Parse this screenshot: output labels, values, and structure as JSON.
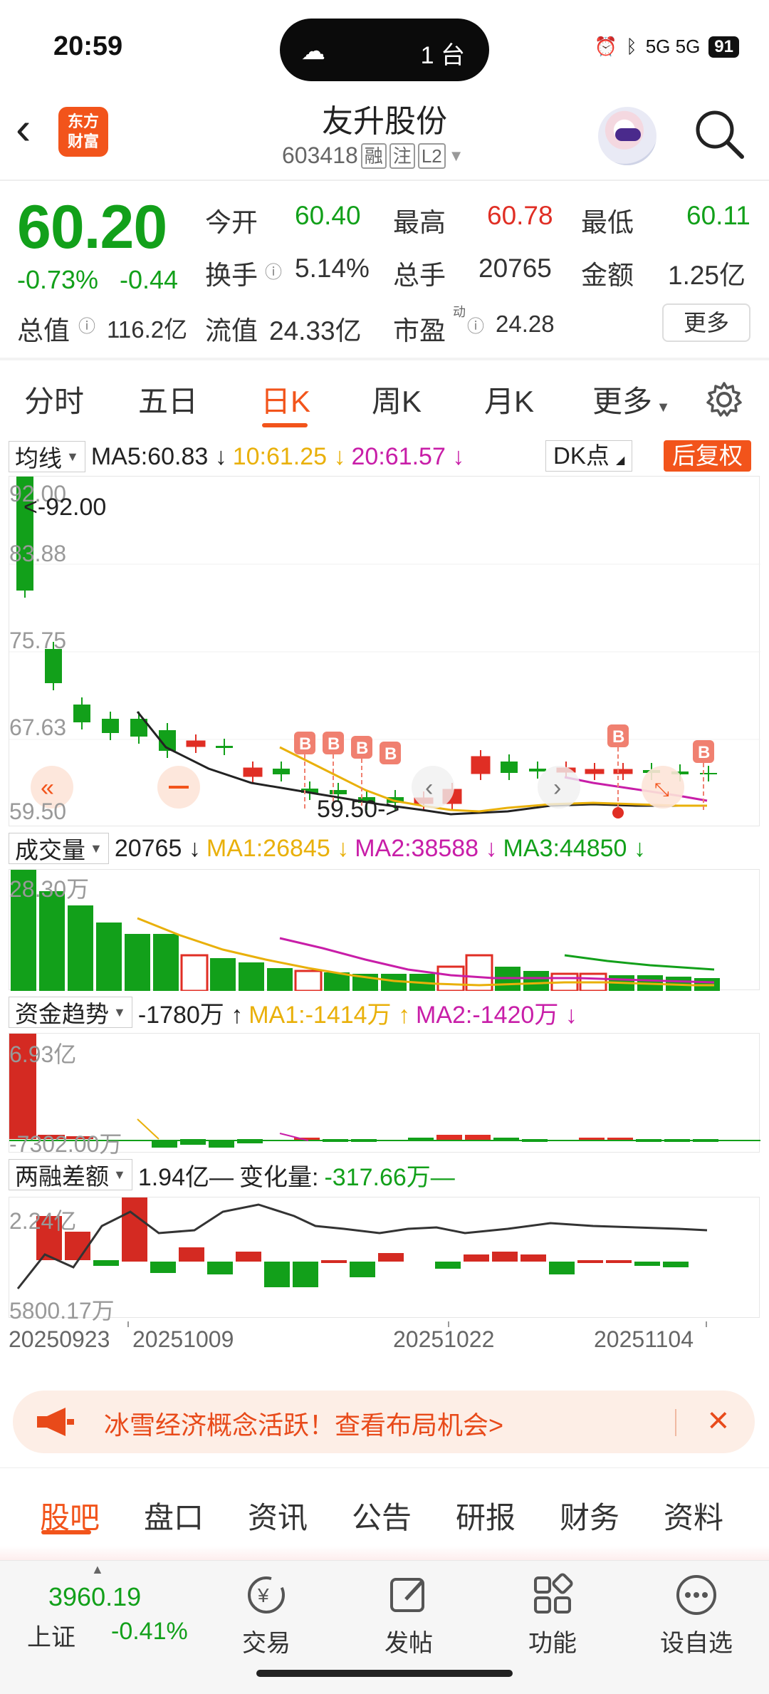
{
  "status_bar": {
    "time": "20:59",
    "island_text": "1 台",
    "network": "5G 5G",
    "battery": "91"
  },
  "header": {
    "logo_line1": "东方",
    "logo_line2": "财富",
    "stock_name": "友升股份",
    "stock_code": "603418",
    "tags": [
      "融",
      "注",
      "L2"
    ]
  },
  "quote": {
    "price": "60.20",
    "change_pct": "-0.73%",
    "change_abs": "-0.44",
    "open_label": "今开",
    "open": "60.40",
    "high_label": "最高",
    "high": "60.78",
    "low_label": "最低",
    "low": "60.11",
    "turnover_label": "换手",
    "turnover": "5.14%",
    "volume_label": "总手",
    "volume": "20765",
    "amount_label": "金额",
    "amount": "1.25亿",
    "mcap_label": "总值",
    "mcap": "116.2亿",
    "float_label": "流值",
    "float": "24.33亿",
    "pe_label": "市盈",
    "pe_sup": "动",
    "pe": "24.28",
    "more_label": "更多"
  },
  "tabs": [
    "分时",
    "五日",
    "日K",
    "周K",
    "月K",
    "更多"
  ],
  "active_tab": "日K",
  "main_chart": {
    "ma_selector": "均线",
    "ma5": "MA5:60.83 ↓",
    "ma10": "10:61.25 ↓",
    "ma20": "20:61.57 ↓",
    "dk_label": "DK点",
    "fq_label": "后复权",
    "y_labels": [
      "92.00",
      "83.88",
      "75.75",
      "67.63",
      "59.50"
    ],
    "high_marker": "<-92.00",
    "low_marker": "59.50->"
  },
  "volume_chart": {
    "selector": "成交量",
    "value": "20765 ↓",
    "ma1": "MA1:26845 ↓",
    "ma2": "MA2:38588 ↓",
    "ma3": "MA3:44850 ↓",
    "y_label": "28.30万"
  },
  "fund_chart": {
    "selector": "资金趋势",
    "value": "-1780万 ↑",
    "ma1": "MA1:-1414万 ↑",
    "ma2": "MA2:-1420万 ↓",
    "y_top": "6.93亿",
    "y_bottom": "-7302.00万"
  },
  "margin_chart": {
    "selector": "两融差额",
    "value": "1.94亿—",
    "change_label": "变化量:",
    "change_value": "-317.66万—",
    "y_top": "2.24亿",
    "y_bottom": "5800.17万"
  },
  "x_labels": [
    "20250923",
    "20251009",
    "20251022",
    "20251104"
  ],
  "banner": {
    "text": "冰雪经济概念活跃！查看布局机会>"
  },
  "bottom_tabs": [
    "股吧",
    "盘口",
    "资讯",
    "公告",
    "研报",
    "财务",
    "资料"
  ],
  "nav": {
    "index_value": "3960.19",
    "index_name": "上证",
    "index_change": "-0.41%",
    "items": [
      "交易",
      "发帖",
      "功能",
      "设自选"
    ]
  },
  "colors": {
    "up": "#e02e24",
    "down": "#12a01a",
    "accent": "#f2541b"
  }
}
